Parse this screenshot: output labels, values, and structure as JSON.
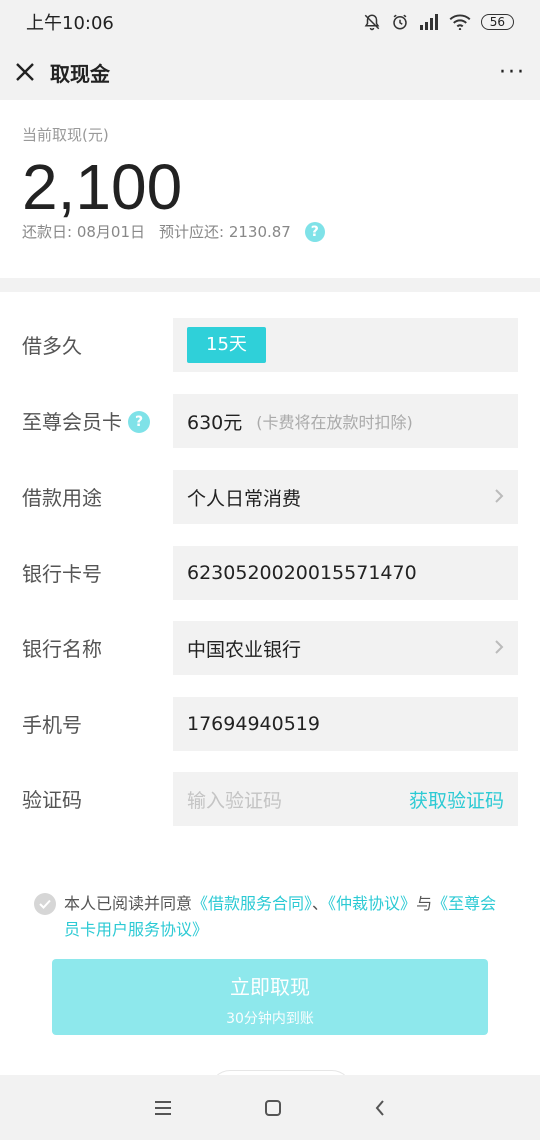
{
  "status_bar": {
    "time": "上午10:06",
    "battery": "56"
  },
  "nav": {
    "title": "取现金",
    "more": "···"
  },
  "summary": {
    "label": "当前取现(元)",
    "amount": "2,100",
    "repay_date": "还款日: 08月01日",
    "expected_repay": "预计应还: 2130.87",
    "help": "?"
  },
  "form": {
    "duration": {
      "label": "借多久",
      "value": "15天"
    },
    "membership": {
      "label": "至尊会员卡",
      "help": "?",
      "value": "630元",
      "note": "(卡费将在放款时扣除)"
    },
    "purpose": {
      "label": "借款用途",
      "value": "个人日常消费"
    },
    "card_number": {
      "label": "银行卡号",
      "value": "6230520020015571470"
    },
    "bank_name": {
      "label": "银行名称",
      "value": "中国农业银行"
    },
    "phone": {
      "label": "手机号",
      "value": "17694940519"
    },
    "code": {
      "label": "验证码",
      "placeholder": "输入验证码",
      "action": "获取验证码"
    }
  },
  "agreement": {
    "prefix": "本人已阅读并同意",
    "link1": "《借款服务合同》",
    "sep1": "、",
    "link2": "《仲裁协议》",
    "sep2": "与",
    "link3": "《至尊会员卡用户服务协议》"
  },
  "submit": {
    "label": "立即取现",
    "sub": "30分钟内到账"
  },
  "colors": {
    "accent": "#2fd0d9",
    "button": "#8ee8ec",
    "link": "#2ccad4"
  }
}
